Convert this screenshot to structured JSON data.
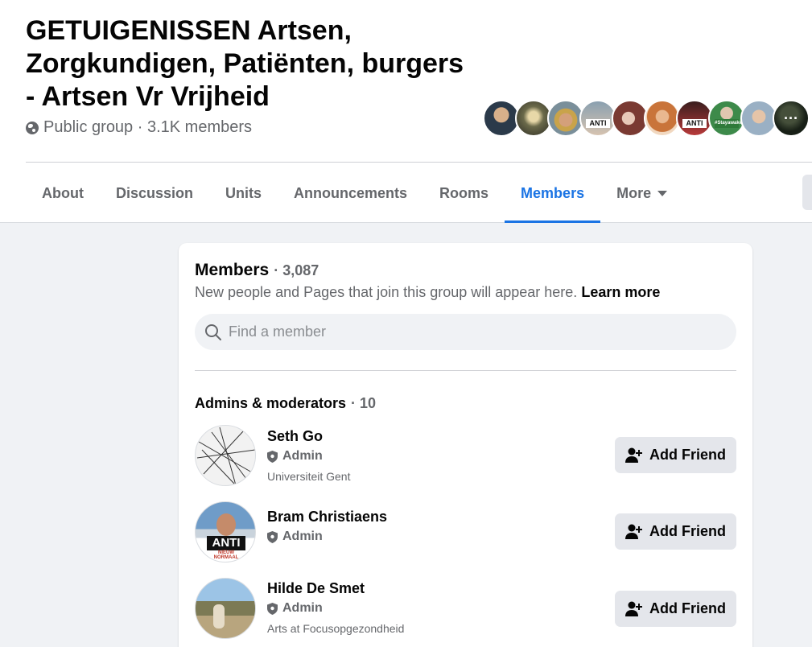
{
  "group": {
    "title": "GETUIGENISSEN Artsen, Zorgkundigen, Patiënten, burgers - Artsen Vr Vrijheid",
    "meta": "Public group · 3.1K members"
  },
  "facepile": [
    {
      "badge": ""
    },
    {
      "badge": ""
    },
    {
      "badge": ""
    },
    {
      "badge": "ANTI"
    },
    {
      "badge": ""
    },
    {
      "badge": ""
    },
    {
      "badge": "ANTI"
    },
    {
      "badge": "#Stayawake"
    },
    {
      "badge": ""
    },
    {
      "badge": "",
      "more": "···"
    }
  ],
  "tabs": [
    {
      "label": "About"
    },
    {
      "label": "Discussion"
    },
    {
      "label": "Units"
    },
    {
      "label": "Announcements"
    },
    {
      "label": "Rooms"
    },
    {
      "label": "Members",
      "active": true
    },
    {
      "label": "More"
    }
  ],
  "members_card": {
    "title": "Members",
    "count": "· 3,087",
    "subtitle": "New people and Pages that join this group will appear here.",
    "learn_more": "Learn more",
    "search_placeholder": "Find a member",
    "admins_title": "Admins & moderators",
    "admins_count": "· 10"
  },
  "members": [
    {
      "name": "Seth Go",
      "role": "Admin",
      "meta": "Universiteit Gent",
      "button": "Add Friend"
    },
    {
      "name": "Bram Christiaens",
      "role": "Admin",
      "meta": "",
      "button": "Add Friend"
    },
    {
      "name": "Hilde De Smet",
      "role": "Admin",
      "meta": "Arts at Focusopgezondheid",
      "button": "Add Friend"
    }
  ],
  "member_avatars": [
    {
      "badge": ""
    },
    {
      "badge": "ANTI",
      "badge_sub": "NIEUW NORMAAL"
    },
    {
      "badge": ""
    }
  ],
  "colors": {
    "accent": "#1b74e4",
    "secondary_text": "#65676b",
    "button_bg": "#e4e6eb",
    "page_bg": "#f0f2f5"
  }
}
